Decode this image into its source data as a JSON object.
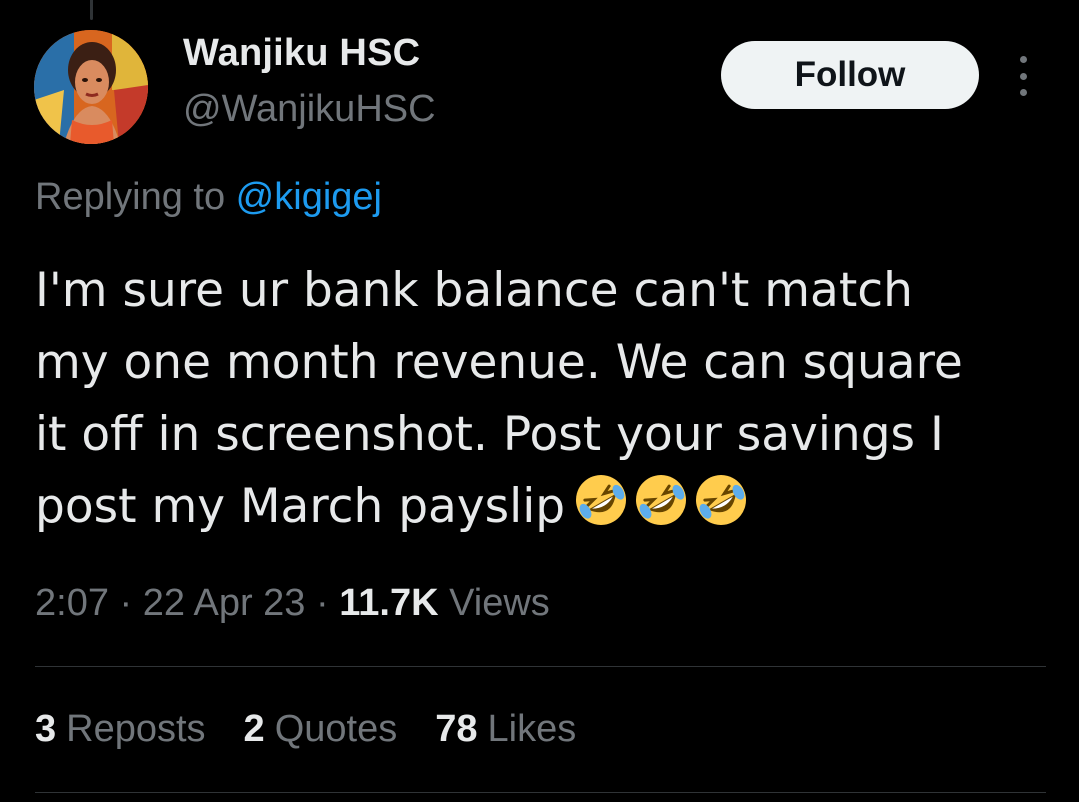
{
  "user": {
    "display_name": "Wanjiku HSC",
    "handle": "@WanjikuHSC"
  },
  "header": {
    "follow_label": "Follow",
    "more_icon": "more-vertical-icon"
  },
  "reply": {
    "prefix": "Replying to ",
    "mention": "@kigigej"
  },
  "tweet": {
    "text": "I'm sure ur bank balance can't match\nmy one month revenue. We can square\nit off in screenshot. Post your savings I\npost my March payslip",
    "emoji": [
      "rolling-on-floor-laughing",
      "rolling-on-floor-laughing",
      "rolling-on-floor-laughing"
    ]
  },
  "meta": {
    "time": "2:07",
    "separator": "·",
    "date": "22 Apr 23",
    "views_count": "11.7K",
    "views_label": "Views"
  },
  "stats": {
    "reposts_count": "3",
    "reposts_label": "Reposts",
    "quotes_count": "2",
    "quotes_label": "Quotes",
    "likes_count": "78",
    "likes_label": "Likes"
  },
  "colors": {
    "background": "#000000",
    "text_primary": "#e7e9ea",
    "text_secondary": "#71767b",
    "link": "#1d9bf0",
    "divider": "#2f3336",
    "button_bg": "#eff3f4"
  }
}
